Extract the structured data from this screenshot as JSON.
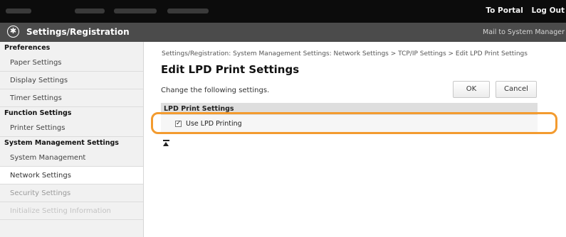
{
  "topbar": {
    "links": [
      "To Portal",
      "Log Out"
    ]
  },
  "header": {
    "title": "Settings/Registration",
    "mail_link": "Mail to System Manager"
  },
  "sidebar": {
    "groups": [
      {
        "heading": "Preferences",
        "items": [
          "Paper Settings",
          "Display Settings",
          "Timer Settings"
        ]
      },
      {
        "heading": "Function Settings",
        "items": [
          "Printer Settings"
        ]
      },
      {
        "heading": "System Management Settings",
        "items": [
          "System Management",
          "Network Settings",
          "Security Settings",
          "Initialize Setting Information"
        ]
      }
    ],
    "active_item": "Network Settings"
  },
  "main": {
    "breadcrumb": "Settings/Registration: System Management Settings: Network Settings > TCP/IP Settings > Edit LPD Print Settings",
    "title": "Edit LPD Print Settings",
    "instruction": "Change the following settings.",
    "ok_label": "OK",
    "cancel_label": "Cancel",
    "section_heading": "LPD Print Settings",
    "checkbox_label": "Use LPD Printing",
    "checkbox_checked": true
  },
  "colors": {
    "highlight": "#f39b2f",
    "header_bg": "#4b4b4b",
    "topbar_bg": "#0c0c0c"
  }
}
